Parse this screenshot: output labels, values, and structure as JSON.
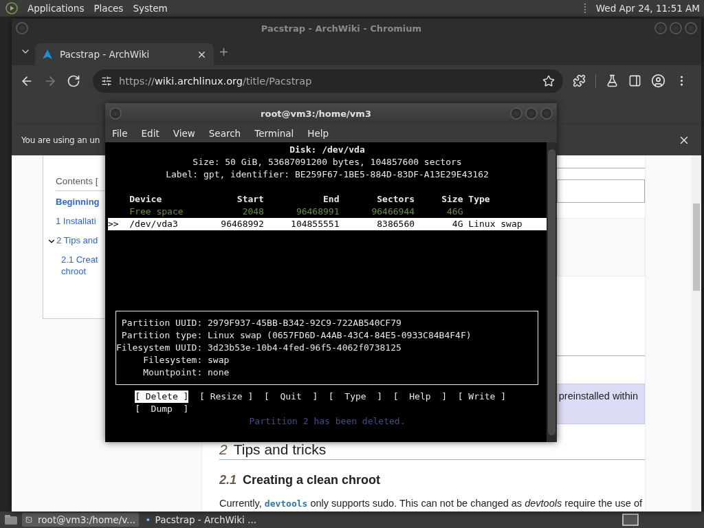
{
  "top_panel": {
    "menus": [
      "Applications",
      "Places",
      "System"
    ],
    "clock": "Wed Apr 24, 11:51 AM"
  },
  "browser": {
    "title": "Pacstrap - ArchWiki - Chromium",
    "tabs": [
      {
        "label": "Pacstrap - ArchWiki",
        "selected": true
      }
    ],
    "nav": [
      {
        "kind": "back",
        "disabled": false
      },
      {
        "kind": "forward",
        "disabled": true
      },
      {
        "kind": "reload",
        "disabled": false
      }
    ],
    "address": [
      {
        "text": "https://",
        "strong": false
      },
      {
        "text": "wiki.archlinux.org",
        "strong": true
      },
      {
        "text": "/title/Pacstrap",
        "strong": false
      }
    ],
    "infobar": {
      "message": "You are using an un"
    },
    "page": {
      "toc": {
        "title": "Contents [",
        "items": [
          {
            "label": "Beginning",
            "selected": true
          },
          {
            "number": "1",
            "label": "Installati",
            "selected": false
          },
          {
            "number": "2",
            "label": "Tips and",
            "selected": false,
            "expanded": true,
            "children": [
              {
                "number": "2.1",
                "lines": [
                  "Creat",
                  "chroot"
                ],
                "selected": false
              }
            ]
          }
        ]
      },
      "note": "preinstalled within",
      "headings": [
        {
          "kind": "h2",
          "number": "2",
          "title": "Tips and tricks"
        },
        {
          "kind": "h3",
          "number": "2.1",
          "title": "Creating a clean chroot"
        }
      ],
      "paragraph": [
        {
          "text": "Currently, ",
          "kind": "plain"
        },
        {
          "text": "devtools",
          "kind": "code-link"
        },
        {
          "text": " only supports sudo. This can not be changed as ",
          "kind": "plain"
        },
        {
          "text": "devtools",
          "kind": "italic"
        },
        {
          "text": " require the use of",
          "kind": "plain"
        }
      ]
    }
  },
  "terminal": {
    "title": "root@vm3:/home/vm3",
    "menu": [
      "File",
      "Edit",
      "View",
      "Search",
      "Terminal",
      "Help"
    ],
    "disk_title": "Disk: /dev/vda",
    "disk_lines": [
      "Size: 50 GiB, 53687091200 bytes, 104857600 sectors",
      "Label: gpt, identifier: BE259F67-1BE5-884D-83DF-A13E29E43162"
    ],
    "columns": [
      "Device",
      "Start",
      "End",
      "Sectors",
      "Size",
      "Type"
    ],
    "rows": [
      {
        "kind": "free",
        "selected": false,
        "device": "Free space",
        "start": "2048",
        "end": "96468991",
        "sectors": "96466944",
        "size": "46G"
      },
      {
        "kind": "partition",
        "selected": true,
        "marker": ">>",
        "device": "/dev/vda3",
        "start": "96468992",
        "end": "104855551",
        "sectors": "8386560",
        "size": "4G",
        "type": "Linux swap"
      }
    ],
    "details": [
      {
        "label": "Partition UUID:",
        "value": "2979F937-45BB-B342-92C9-722AB540CF79"
      },
      {
        "label": "Partition type:",
        "value": "Linux swap (0657FD6D-A4AB-43C4-84E5-0933C84B4F4F)"
      },
      {
        "label": "Filesystem UUID:",
        "value": "3d23b53e-10b4-4fed-96f5-4062f0738125"
      },
      {
        "label": "Filesystem:",
        "value": "swap"
      },
      {
        "label": "Mountpoint:",
        "value": "none"
      }
    ],
    "actions": [
      {
        "label": "[ Delete ]",
        "selected": true
      },
      {
        "label": "[ Resize ]",
        "selected": false
      },
      {
        "label": "[  Quit  ]",
        "selected": false
      },
      {
        "label": "[  Type  ]",
        "selected": false
      },
      {
        "label": "[  Help  ]",
        "selected": false
      },
      {
        "label": "[ Write ]",
        "selected": false
      },
      {
        "label": "[  Dump  ]",
        "selected": false
      }
    ],
    "status": "Partition 2 has been deleted."
  },
  "taskbar": {
    "tasks": [
      {
        "label": "root@vm3:/home/v...",
        "kind": "terminal",
        "selected": true
      },
      {
        "label": "Pacstrap - ArchWiki ...",
        "kind": "browser",
        "selected": false
      }
    ]
  }
}
